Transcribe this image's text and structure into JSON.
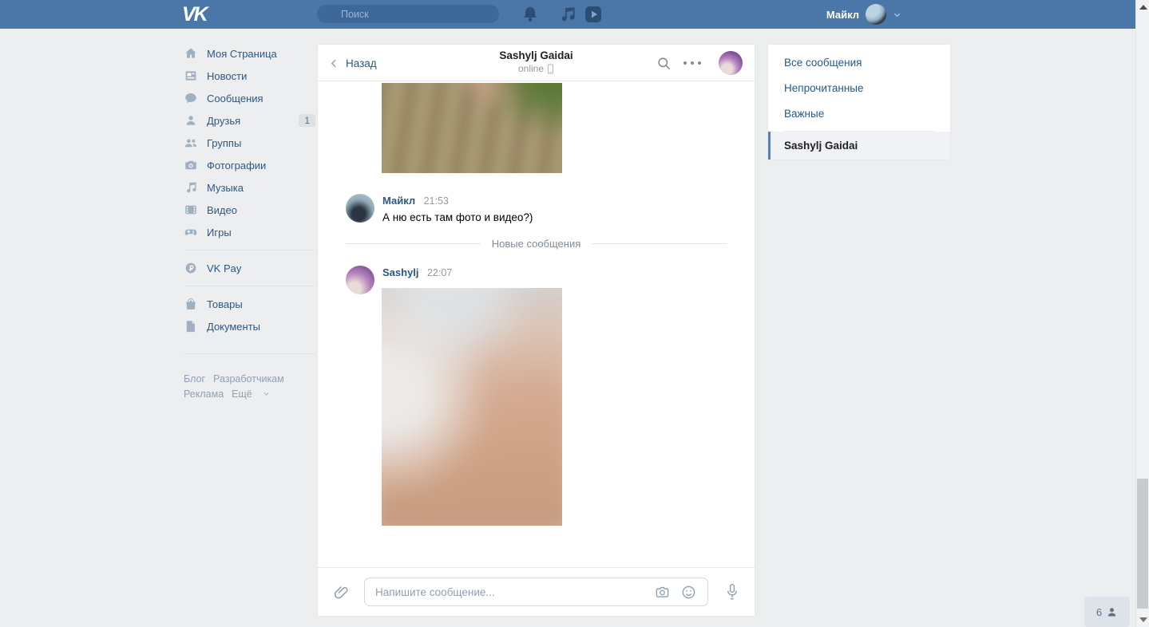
{
  "colors": {
    "header_blue": "#4a76a8",
    "link_blue": "#2a5885",
    "accent_blue": "#5181b8",
    "page_bg": "#edeef0",
    "card_border": "#e7e8ec"
  },
  "topbar": {
    "logo": "VK",
    "search_placeholder": "Поиск",
    "icons": [
      "bell-icon",
      "music-icon",
      "video-play-icon"
    ],
    "user_name": "Майкл"
  },
  "sidebar": {
    "items": [
      {
        "icon": "home-icon",
        "label": "Моя Страница"
      },
      {
        "icon": "news-icon",
        "label": "Новости"
      },
      {
        "icon": "messages-icon",
        "label": "Сообщения"
      },
      {
        "icon": "friends-icon",
        "label": "Друзья",
        "badge": "1"
      },
      {
        "icon": "groups-icon",
        "label": "Группы"
      },
      {
        "icon": "photos-icon",
        "label": "Фотографии"
      },
      {
        "icon": "music-icon",
        "label": "Музыка"
      },
      {
        "icon": "video-icon",
        "label": "Видео"
      },
      {
        "icon": "games-icon",
        "label": "Игры"
      },
      {
        "icon": "vkpay-icon",
        "label": "VK Pay"
      },
      {
        "icon": "market-icon",
        "label": "Товары"
      },
      {
        "icon": "docs-icon",
        "label": "Документы"
      }
    ],
    "footer_links": {
      "blog": "Блог",
      "dev": "Разработчикам",
      "ads": "Реклама",
      "more": "Ещё"
    }
  },
  "chat": {
    "back_label": "Назад",
    "title": "Sashylj Gaidai",
    "status": "online",
    "status_device_icon": "mobile-icon",
    "partial_photo_above": {
      "type": "photo-attachment",
      "note": "top-cropped by scroll"
    },
    "messages": [
      {
        "author": "Майкл",
        "time": "21:53",
        "text": "А ню есть там фото и видео?)",
        "attachment": null
      },
      {
        "author": "Sashylj",
        "time": "22:07",
        "text": "",
        "attachment": "photo"
      }
    ],
    "new_messages_divider": "Новые сообщения",
    "input_placeholder": "Напишите сообщение...",
    "input_icons": [
      "paperclip-icon",
      "camera-icon",
      "smiley-icon",
      "microphone-icon"
    ]
  },
  "filters_panel": {
    "items": [
      {
        "label": "Все сообщения"
      },
      {
        "label": "Непрочитанные"
      },
      {
        "label": "Важные"
      }
    ],
    "selected_chat": "Sashylj Gaidai"
  },
  "online_widget": {
    "count": "6",
    "icon": "person-icon"
  }
}
